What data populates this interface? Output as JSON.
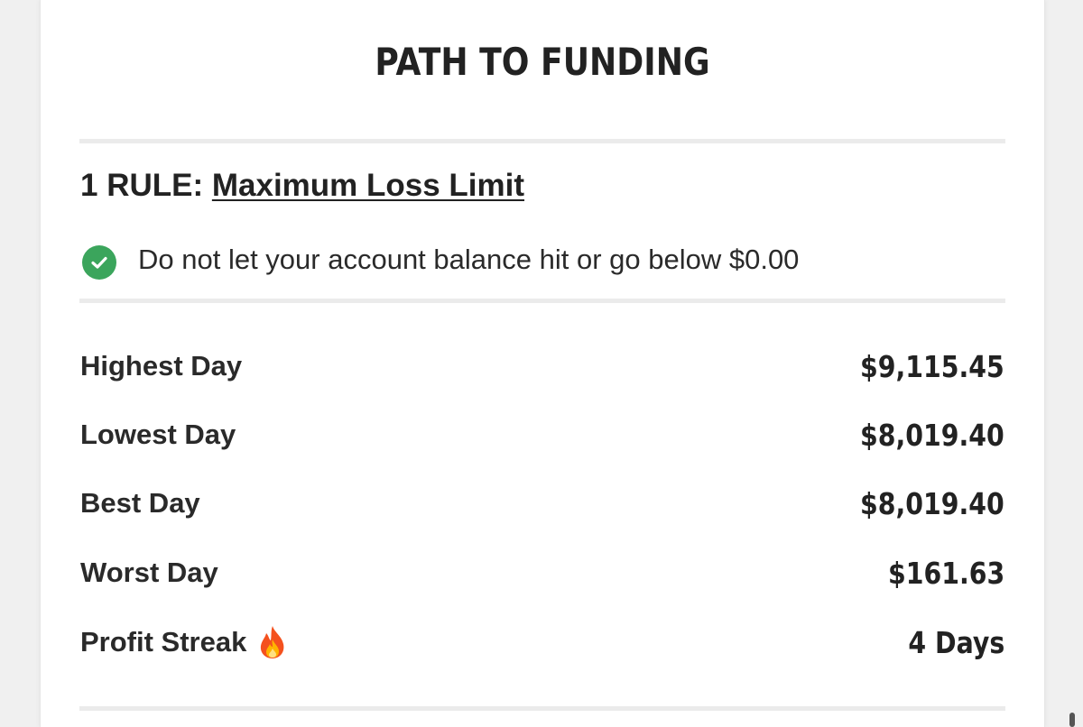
{
  "title": "PATH TO FUNDING",
  "rule": {
    "prefix": "1 RULE: ",
    "link_label": "Maximum Loss Limit",
    "item_text": "Do not let your account balance hit or go below $0.00",
    "status_icon": "check-circle-icon",
    "status_color": "#3ba55c"
  },
  "stats": [
    {
      "label": "Highest Day",
      "value": "$9,115.45"
    },
    {
      "label": "Lowest Day",
      "value": "$8,019.40"
    },
    {
      "label": "Best Day",
      "value": "$8,019.40"
    },
    {
      "label": "Worst Day",
      "value": "$161.63"
    },
    {
      "label": "Profit Streak",
      "value": "4 Days",
      "icon": "fire-icon"
    }
  ]
}
